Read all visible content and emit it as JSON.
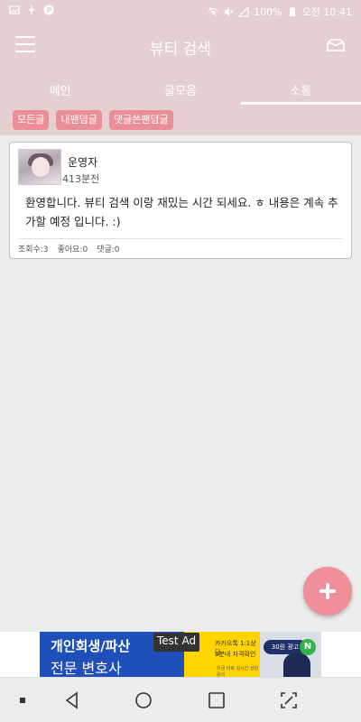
{
  "status_bar": {
    "battery": "100%",
    "time": "오전 10:41"
  },
  "app_bar": {
    "title": "뷰티 검색"
  },
  "tabs": [
    {
      "label": "메인",
      "active": false
    },
    {
      "label": "글모음",
      "active": false
    },
    {
      "label": "소통",
      "active": true
    }
  ],
  "filters": [
    "모든글",
    "내팬덤글",
    "댓글쓴팬덤글"
  ],
  "post": {
    "author": "운영자",
    "time_ago": "413분전",
    "body": "환영합니다. 뷰티 검색 이랑 재밌는 시간 되세요. ㅎ 내용은 계속 추가할 예정 입니다. :)",
    "views": "조회수:3",
    "likes": "좋아요:0",
    "comments": "댓글:0"
  },
  "ad": {
    "badge": "Test Ad",
    "headline": "개인회생/파산",
    "subline": "전문 변호사",
    "pill": "30원 광고",
    "mid_line1": "카카오톡 1:1상담",
    "mid_line2": "5분내 자격확인",
    "mid_line3": "지금 바로 실시간 상담 문의",
    "logo_letter": "N"
  },
  "colors": {
    "header": "#e5cfd1",
    "accent": "#ea8e98",
    "fab": "#ee8f99",
    "background": "#ececec"
  }
}
